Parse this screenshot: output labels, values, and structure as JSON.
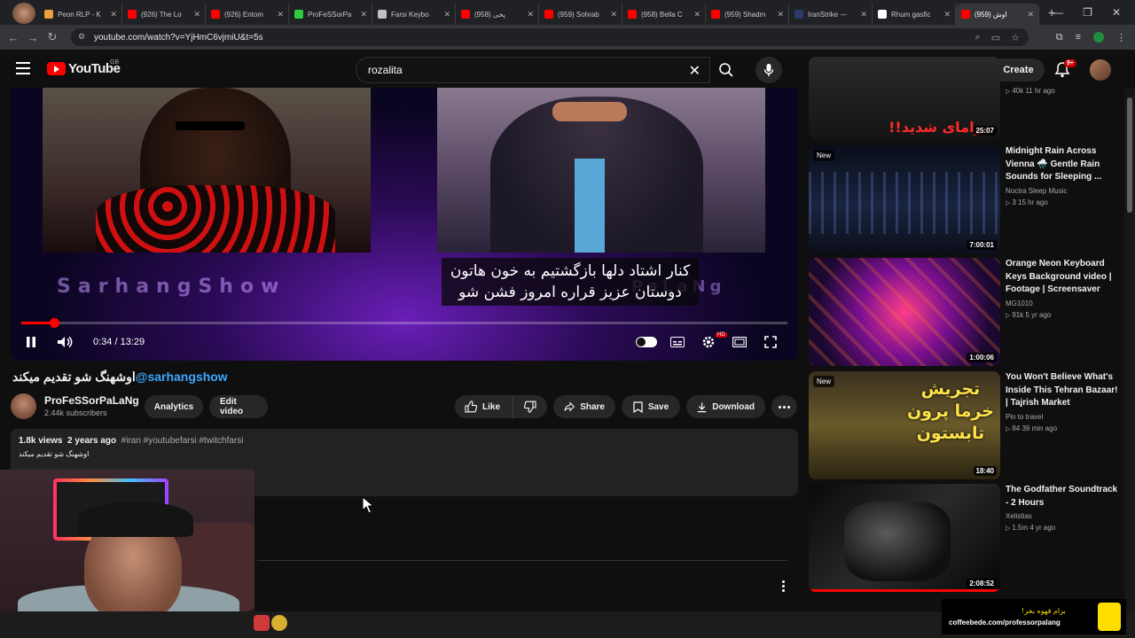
{
  "browser": {
    "tabs": [
      {
        "label": "Peon RLP - K",
        "color": "#e8a040"
      },
      {
        "label": "(926) The Lo",
        "color": "#ff0000"
      },
      {
        "label": "(926) Entom",
        "color": "#ff0000"
      },
      {
        "label": "ProFeSSorPa",
        "color": "#2ecc40"
      },
      {
        "label": "Farsi Keybo",
        "color": "#c0c0c0"
      },
      {
        "label": "(958) پخی",
        "color": "#ff0000"
      },
      {
        "label": "(959) Sohrab",
        "color": "#ff0000"
      },
      {
        "label": "(958) Bella C",
        "color": "#ff0000"
      },
      {
        "label": "(959) Shadm",
        "color": "#ff0000"
      },
      {
        "label": "IranStrike —",
        "color": "#2a3a6a"
      },
      {
        "label": "Rhum gasfic",
        "color": "#ffffff"
      },
      {
        "label": "(959) اوش",
        "color": "#ff0000"
      }
    ],
    "url": "youtube.com/watch?v=YjHmC6vjmiU&t=5s"
  },
  "header": {
    "logo_text": "YouTube",
    "country": "GB",
    "search_value": "rozalita",
    "create_label": "Create",
    "notif_count": "9+"
  },
  "player": {
    "subtitle_line1": "کنار اشتاد دلها بازگشتیم به خون هاتون",
    "subtitle_line2": "دوستان عزیز قراره امروز فشن شو",
    "banner_left": "SarhangShow",
    "banner_right": "PaLaNg",
    "time": "0:34 / 13:29",
    "progress": 0.043
  },
  "video": {
    "title_fa": "اوشهنگ شو تقدیم میکند",
    "title_tag": "@sarhangshow",
    "channel": "ProFeSSorPaLaNg",
    "subscribers": "2.44k subscribers",
    "analytics": "Analytics",
    "edit": "Edit video",
    "like": "Like",
    "share": "Share",
    "save": "Save",
    "download": "Download",
    "views": "1.8k views",
    "age": "2 years ago",
    "hashtags": "#iran #youtubefarsi #twitchfarsi",
    "desc": "اوشهنگ شو تقدیم میکند"
  },
  "recs": [
    {
      "title": "",
      "channel": "",
      "meta": "40k  11 hr ago",
      "duration": "25:07",
      "new": "",
      "thumb_text": "درامای شدید!!"
    },
    {
      "title": "Midnight Rain Across Vienna 🌧️ Gentle Rain Sounds for Sleeping ...",
      "channel": "Noctra Sleep Music",
      "meta": "3  15 hr ago",
      "duration": "7:00:01",
      "new": "New"
    },
    {
      "title": "Orange Neon Keyboard Keys Background video | Footage | Screensaver",
      "channel": "MG1010",
      "meta": "91k  5 yr ago",
      "duration": "1:00:06",
      "new": ""
    },
    {
      "title": "You Won't Believe What's Inside This Tehran Bazaar! | Tajrish Market",
      "channel": "Pin to travel",
      "meta": "84  39 min ago",
      "duration": "18:40",
      "new": "New",
      "thumb_text": "تجریش خرما پرون تابستون"
    },
    {
      "title": "The Godfather Soundtrack - 2 Hours",
      "channel": "Xelistias",
      "meta": "1.5m  4 yr ago",
      "duration": "2:08:52",
      "new": ""
    }
  ],
  "coffee": {
    "top": "برام قهوه بخر!",
    "url": "coffeebede.com/professorpalang"
  },
  "colors": {
    "accent": "#ff0000",
    "link": "#3ea6ff"
  }
}
